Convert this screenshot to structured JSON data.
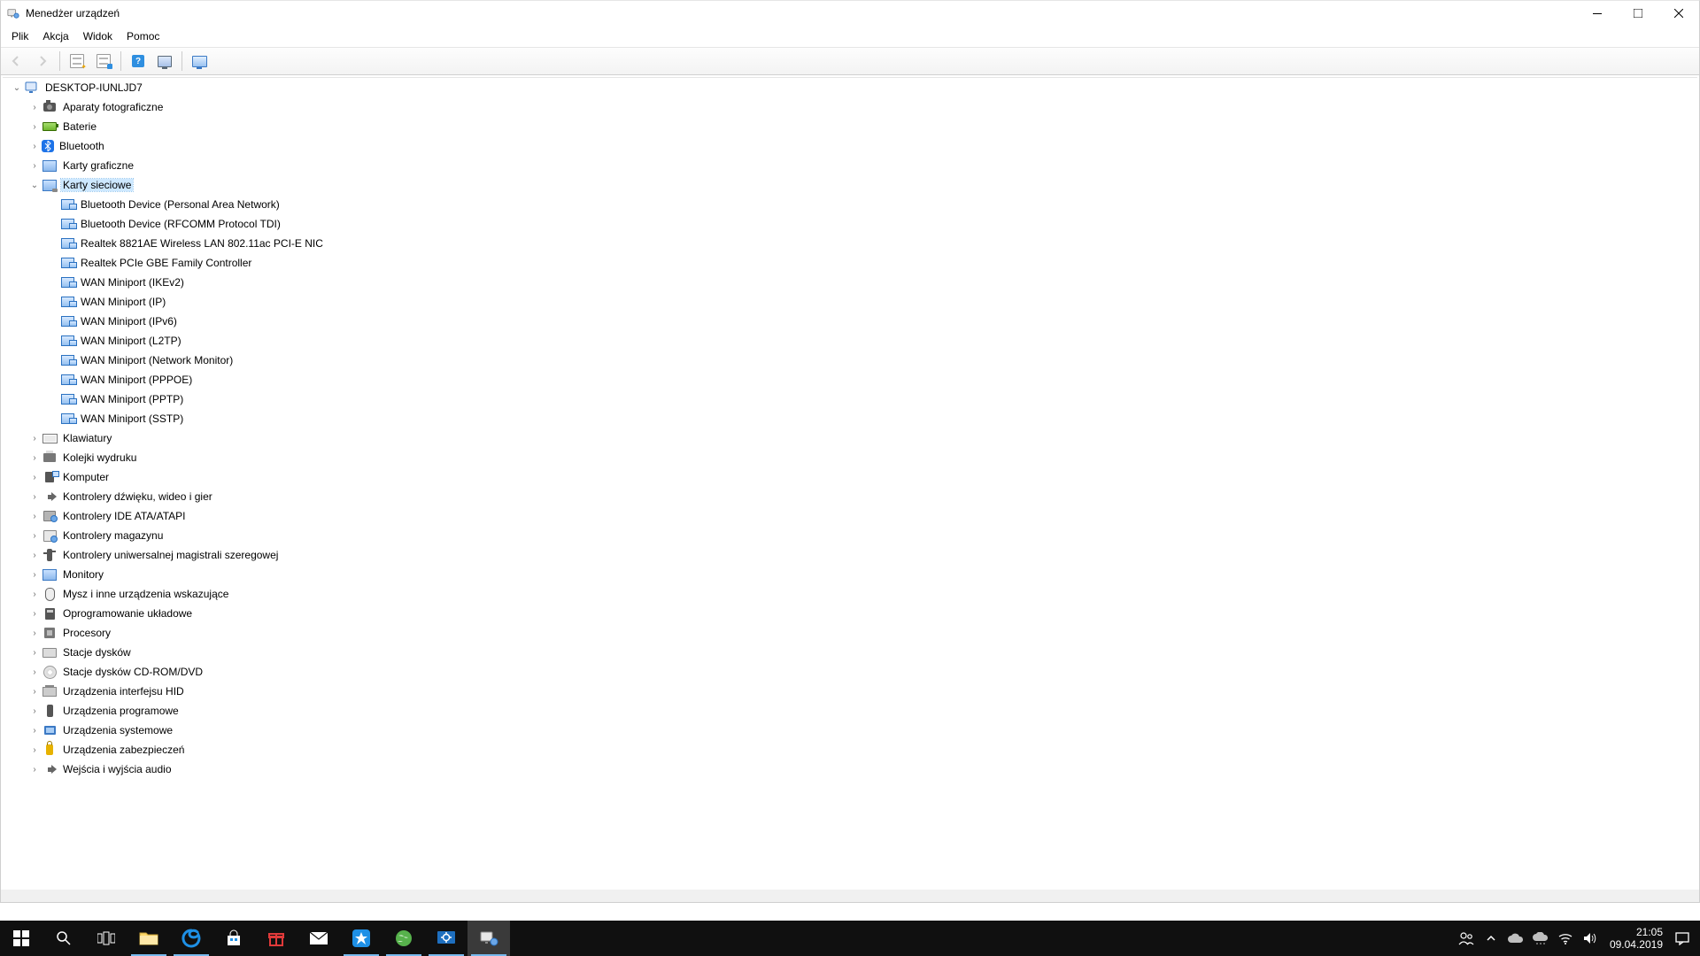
{
  "window": {
    "title": "Menedżer urządzeń"
  },
  "menu": {
    "file": "Plik",
    "action": "Akcja",
    "view": "Widok",
    "help": "Pomoc"
  },
  "tree": {
    "root": "DESKTOP-IUNLJD7",
    "cat_cameras": "Aparaty fotograficzne",
    "cat_batteries": "Baterie",
    "cat_bluetooth": "Bluetooth",
    "cat_gpu": "Karty graficzne",
    "cat_nic": "Karty sieciowe",
    "nic": {
      "a": "Bluetooth Device (Personal Area Network)",
      "b": "Bluetooth Device (RFCOMM Protocol TDI)",
      "c": "Realtek 8821AE Wireless LAN 802.11ac PCI-E NIC",
      "d": "Realtek PCIe GBE Family Controller",
      "e": "WAN Miniport (IKEv2)",
      "f": "WAN Miniport (IP)",
      "g": "WAN Miniport (IPv6)",
      "h": "WAN Miniport (L2TP)",
      "i": "WAN Miniport (Network Monitor)",
      "j": "WAN Miniport (PPPOE)",
      "k": "WAN Miniport (PPTP)",
      "l": "WAN Miniport (SSTP)"
    },
    "cat_kbd": "Klawiatury",
    "cat_print": "Kolejki wydruku",
    "cat_computer": "Komputer",
    "cat_sound": "Kontrolery dźwięku, wideo i gier",
    "cat_ide": "Kontrolery IDE ATA/ATAPI",
    "cat_storage": "Kontrolery magazynu",
    "cat_usb": "Kontrolery uniwersalnej magistrali szeregowej",
    "cat_monitors": "Monitory",
    "cat_mouse": "Mysz i inne urządzenia wskazujące",
    "cat_firmware": "Oprogramowanie układowe",
    "cat_cpu": "Procesory",
    "cat_disks": "Stacje dysków",
    "cat_cd": "Stacje dysków CD-ROM/DVD",
    "cat_hid": "Urządzenia interfejsu HID",
    "cat_soft": "Urządzenia programowe",
    "cat_system": "Urządzenia systemowe",
    "cat_security": "Urządzenia zabezpieczeń",
    "cat_audio": "Wejścia i wyjścia audio"
  },
  "taskbar": {
    "clock_time": "21:05",
    "clock_date": "09.04.2019"
  }
}
